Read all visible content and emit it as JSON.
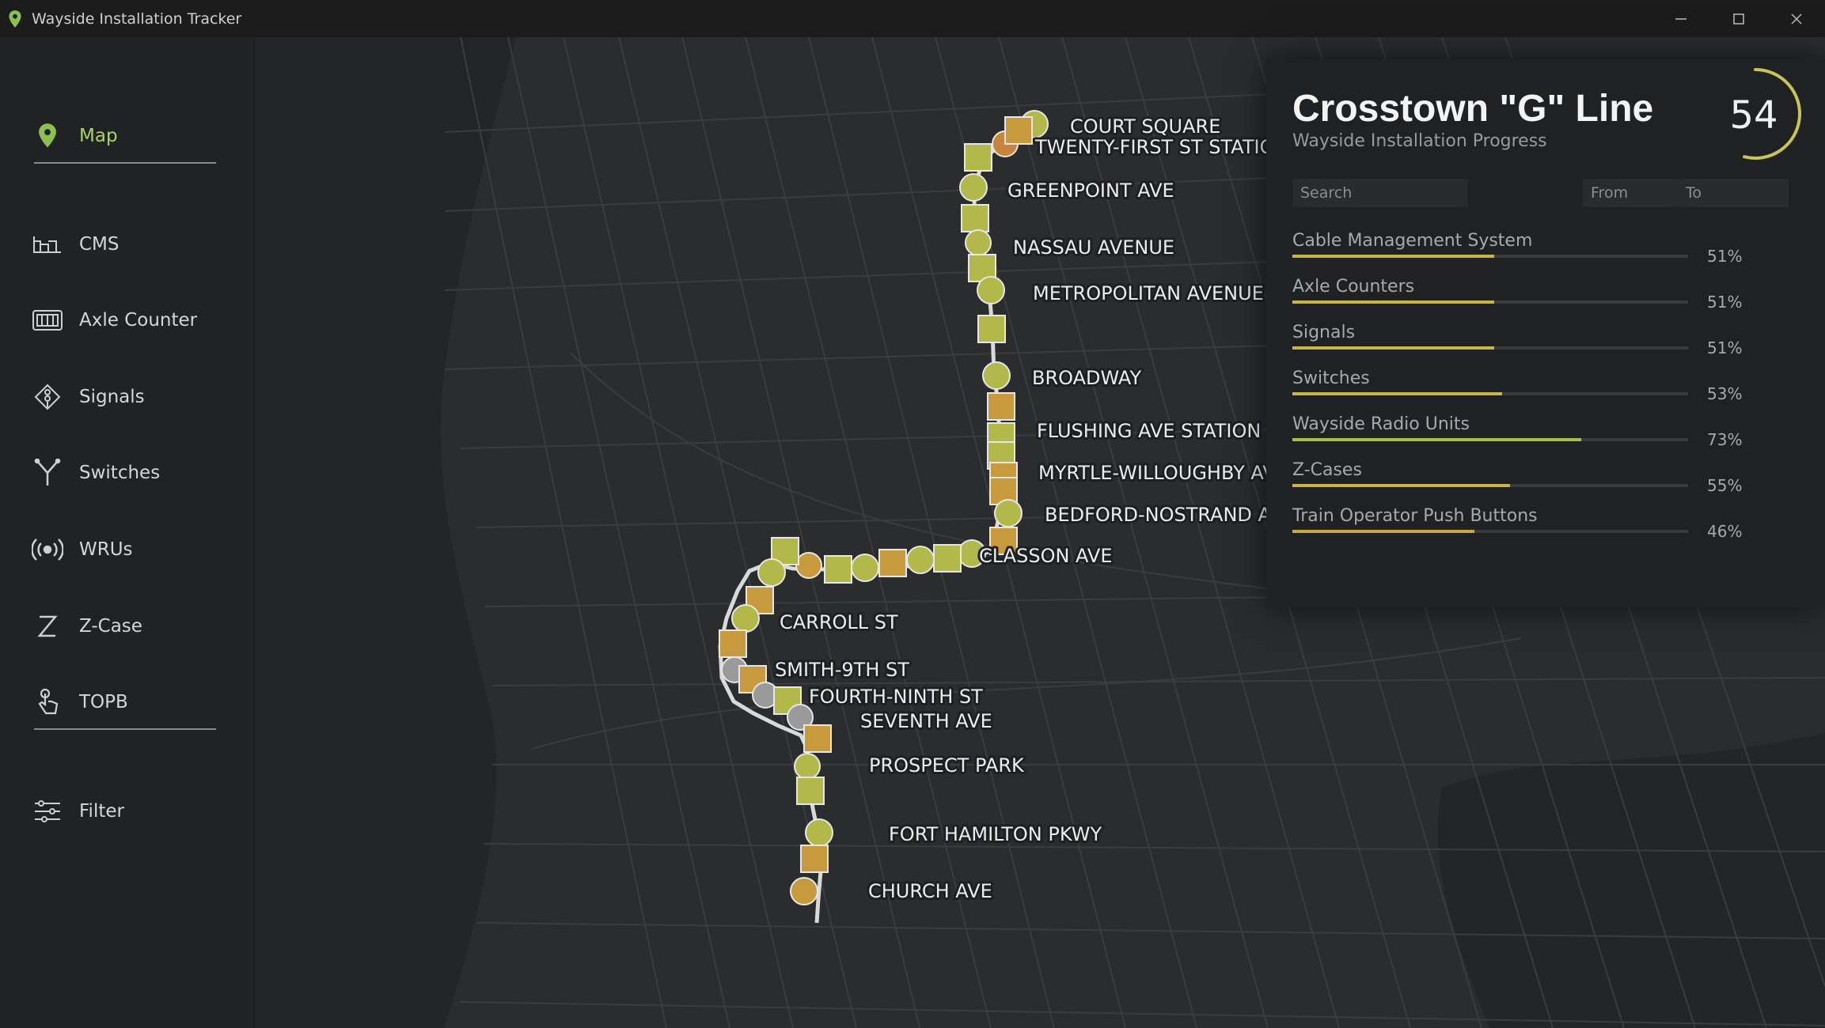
{
  "window": {
    "title": "Wayside Installation Tracker"
  },
  "sidebar": {
    "items": [
      {
        "label": "Map",
        "icon": "map-pin-icon",
        "active": true
      },
      {
        "label": "CMS",
        "icon": "cms-icon"
      },
      {
        "label": "Axle Counter",
        "icon": "axle-counter-icon"
      },
      {
        "label": "Signals",
        "icon": "signal-icon"
      },
      {
        "label": "Switches",
        "icon": "switch-icon"
      },
      {
        "label": "WRUs",
        "icon": "radio-icon"
      },
      {
        "label": "Z-Case",
        "icon": "z-case-icon"
      },
      {
        "label": "TOPB",
        "icon": "push-button-icon"
      },
      {
        "label": "Filter",
        "icon": "filter-sliders-icon"
      }
    ]
  },
  "panel": {
    "title": "Crosstown \"G\" Line",
    "subtitle": "Wayside Installation Progress",
    "overall_progress": "54",
    "search_placeholder": "Search",
    "from_placeholder": "From",
    "to_placeholder": "To",
    "categories": [
      {
        "label": "Cable Management System",
        "percent": "51%",
        "value": 51
      },
      {
        "label": "Axle Counters",
        "percent": "51%",
        "value": 51
      },
      {
        "label": "Signals",
        "percent": "51%",
        "value": 51
      },
      {
        "label": "Switches",
        "percent": "53%",
        "value": 53
      },
      {
        "label": "Wayside Radio Units",
        "percent": "73%",
        "value": 73
      },
      {
        "label": "Z-Cases",
        "percent": "55%",
        "value": 55
      },
      {
        "label": "Train Operator Push Buttons",
        "percent": "46%",
        "value": 46
      }
    ]
  },
  "map": {
    "stations": [
      "COURT SQUARE",
      "TWENTY-FIRST ST STATION",
      "GREENPOINT AVE",
      "NASSAU AVENUE",
      "METROPOLITAN AVENUE",
      "BROADWAY",
      "FLUSHING AVE STATION",
      "MYRTLE-WILLOUGHBY AVE",
      "BEDFORD-NOSTRAND AVE",
      "CLASSON AVE",
      "CARROLL ST",
      "SMITH-9TH ST",
      "FOURTH-NINTH ST",
      "SEVENTH AVE",
      "PROSPECT PARK",
      "FORT HAMILTON PKWY",
      "CHURCH AVE"
    ]
  },
  "colors": {
    "accent": "#a8d46a",
    "olive": "#b3b84a",
    "amber": "#c89a3e",
    "green": "#a0b845",
    "grey": "#9a9a9a"
  }
}
